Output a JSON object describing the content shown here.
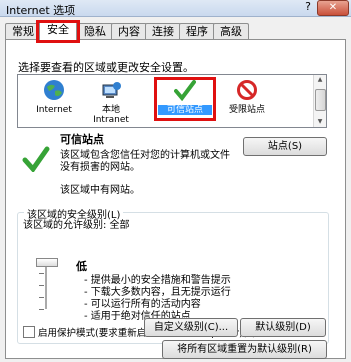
{
  "window": {
    "title": "Internet 选项",
    "help": "?",
    "close": "✕"
  },
  "tabs": [
    "常规",
    "安全",
    "隐私",
    "内容",
    "连接",
    "程序",
    "高级"
  ],
  "security": {
    "prompt": "选择要查看的区域或更改安全设置。",
    "zones": [
      {
        "name": "Internet",
        "icon": "globe-icon"
      },
      {
        "name": "本地\nIntranet",
        "icon": "intranet-icon"
      },
      {
        "name": "可信站点",
        "icon": "checkmark-icon",
        "selected": true
      },
      {
        "name": "受限站点",
        "icon": "restricted-icon"
      }
    ],
    "zone_title": "可信站点",
    "sites_button": "站点(S)",
    "zone_description": "该区域包含您信任对您的计算机或文件没有损害的网站。",
    "zone_note": "该区域中有网站。",
    "level_group_title": "该区域的安全级别(L)",
    "allowed_level": "该区域的允许级别: 全部",
    "level_name": "低",
    "level_bullets": [
      "- 提供最小的安全措施和警告提示",
      "- 下载大多数内容，且无提示运行",
      "- 可以运行所有的活动内容",
      "- 适用于绝对信任的站点"
    ],
    "protected_mode_label": "启用保护模式(要求重新启动 Internet Explorer)(P)",
    "custom_level_button": "自定义级别(C)...",
    "default_level_button": "默认级别(D)",
    "reset_all_button": "将所有区域重置为默认级别(R)"
  },
  "colors": {
    "highlight": "#e01010",
    "selection": "#3399ff"
  }
}
